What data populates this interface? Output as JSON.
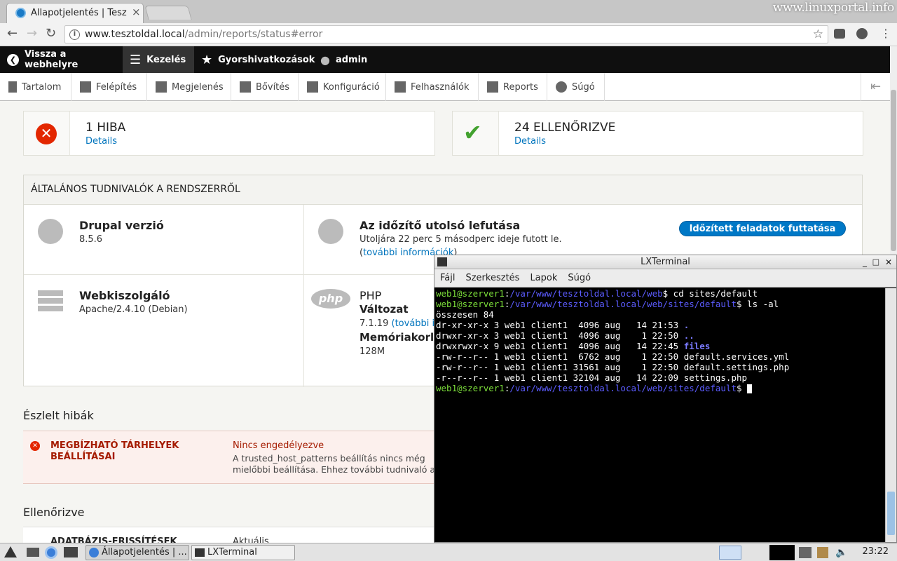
{
  "browser": {
    "tab_title": "Állapotjelentés | Tesz",
    "tab_close": "×",
    "brand": "www.linuxportal.info",
    "url_host": "www.tesztoldal.local",
    "url_path": "/admin/reports/status#error"
  },
  "toolbar": {
    "back": "Vissza a webhelyre",
    "manage": "Kezelés",
    "shortcuts": "Gyorshivatkozások",
    "user": "admin"
  },
  "tray": [
    "Tartalom",
    "Felépítés",
    "Megjelenés",
    "Bővítés",
    "Konfiguráció",
    "Felhasználók",
    "Reports",
    "Súgó"
  ],
  "summary": {
    "errors": "1 HIBA",
    "errors_link": "Details",
    "checked": "24 ELLENŐRIZVE",
    "checked_link": "Details"
  },
  "general": {
    "heading": "ÁLTALÁNOS TUDNIVALÓK A RENDSZERRŐL",
    "drupal_title": "Drupal verzió",
    "drupal_version": "8.5.6",
    "cron_title": "Az időzítő utolsó lefutása",
    "cron_text": "Utoljára 22 perc 5 másodperc ideje futott le.",
    "cron_paren_open": "(",
    "cron_more": "további információk",
    "cron_paren_close": ")",
    "cron_button": "Időzített feladatok futtatása",
    "web_title": "Webkiszolgáló",
    "web_value": "Apache/2.4.10 (Debian)",
    "php_title": "PHP",
    "php_version_label": "Változat",
    "php_version": "7.1.19",
    "php_more": "(további in",
    "php_memory_label": "Memóriakorla",
    "php_memory": "128M"
  },
  "errors_section": {
    "heading": "Észlelt hibák",
    "item_title_1": "MEGBÍZHATÓ TÁRHELYEK",
    "item_title_2": "BEÁLLÍTÁSAI",
    "item_status": "Nincs engedélyezve",
    "item_desc_1": "A trusted_host_patterns beállítás nincs még",
    "item_desc_2": "mielőbbi beállítása. Ehhez további tudnivaló a"
  },
  "checked_section": {
    "heading": "Ellenőrizve",
    "item_title": "ADATBÁZIS-FRISSÍTÉSEK",
    "item_value": "Aktuális"
  },
  "terminal": {
    "title": "LXTerminal",
    "menu": [
      "Fájl",
      "Szerkesztés",
      "Lapok",
      "Súgó"
    ],
    "prompt_user": "web1@szerver1",
    "path1": "/var/www/tesztoldal.local/web",
    "cmd1": " cd sites/default",
    "path2": "/var/www/tesztoldal.local/web/sites/default",
    "cmd2": " ls -al",
    "total": "összesen 84",
    "rows": [
      {
        "perm": "dr-xr-xr-x 3 web1 client1  4096 aug   14 21:53 ",
        "name": ".",
        "dir": true
      },
      {
        "perm": "drwxr-xr-x 3 web1 client1  4096 aug    1 22:50 ",
        "name": "..",
        "dir": true
      },
      {
        "perm": "drwxrwxr-x 9 web1 client1  4096 aug   14 22:45 ",
        "name": "files",
        "dir": true
      },
      {
        "perm": "-rw-r--r-- 1 web1 client1  6762 aug    1 22:50 ",
        "name": "default.services.yml",
        "dir": false
      },
      {
        "perm": "-rw-r--r-- 1 web1 client1 31561 aug    1 22:50 ",
        "name": "default.settings.php",
        "dir": false
      },
      {
        "perm": "-r--r--r-- 1 web1 client1 32104 aug   14 22:09 ",
        "name": "settings.php",
        "dir": false
      }
    ]
  },
  "taskbar": {
    "task1": "Állapotjelentés | ...",
    "task2": "LXTerminal",
    "clock": "23:22"
  }
}
